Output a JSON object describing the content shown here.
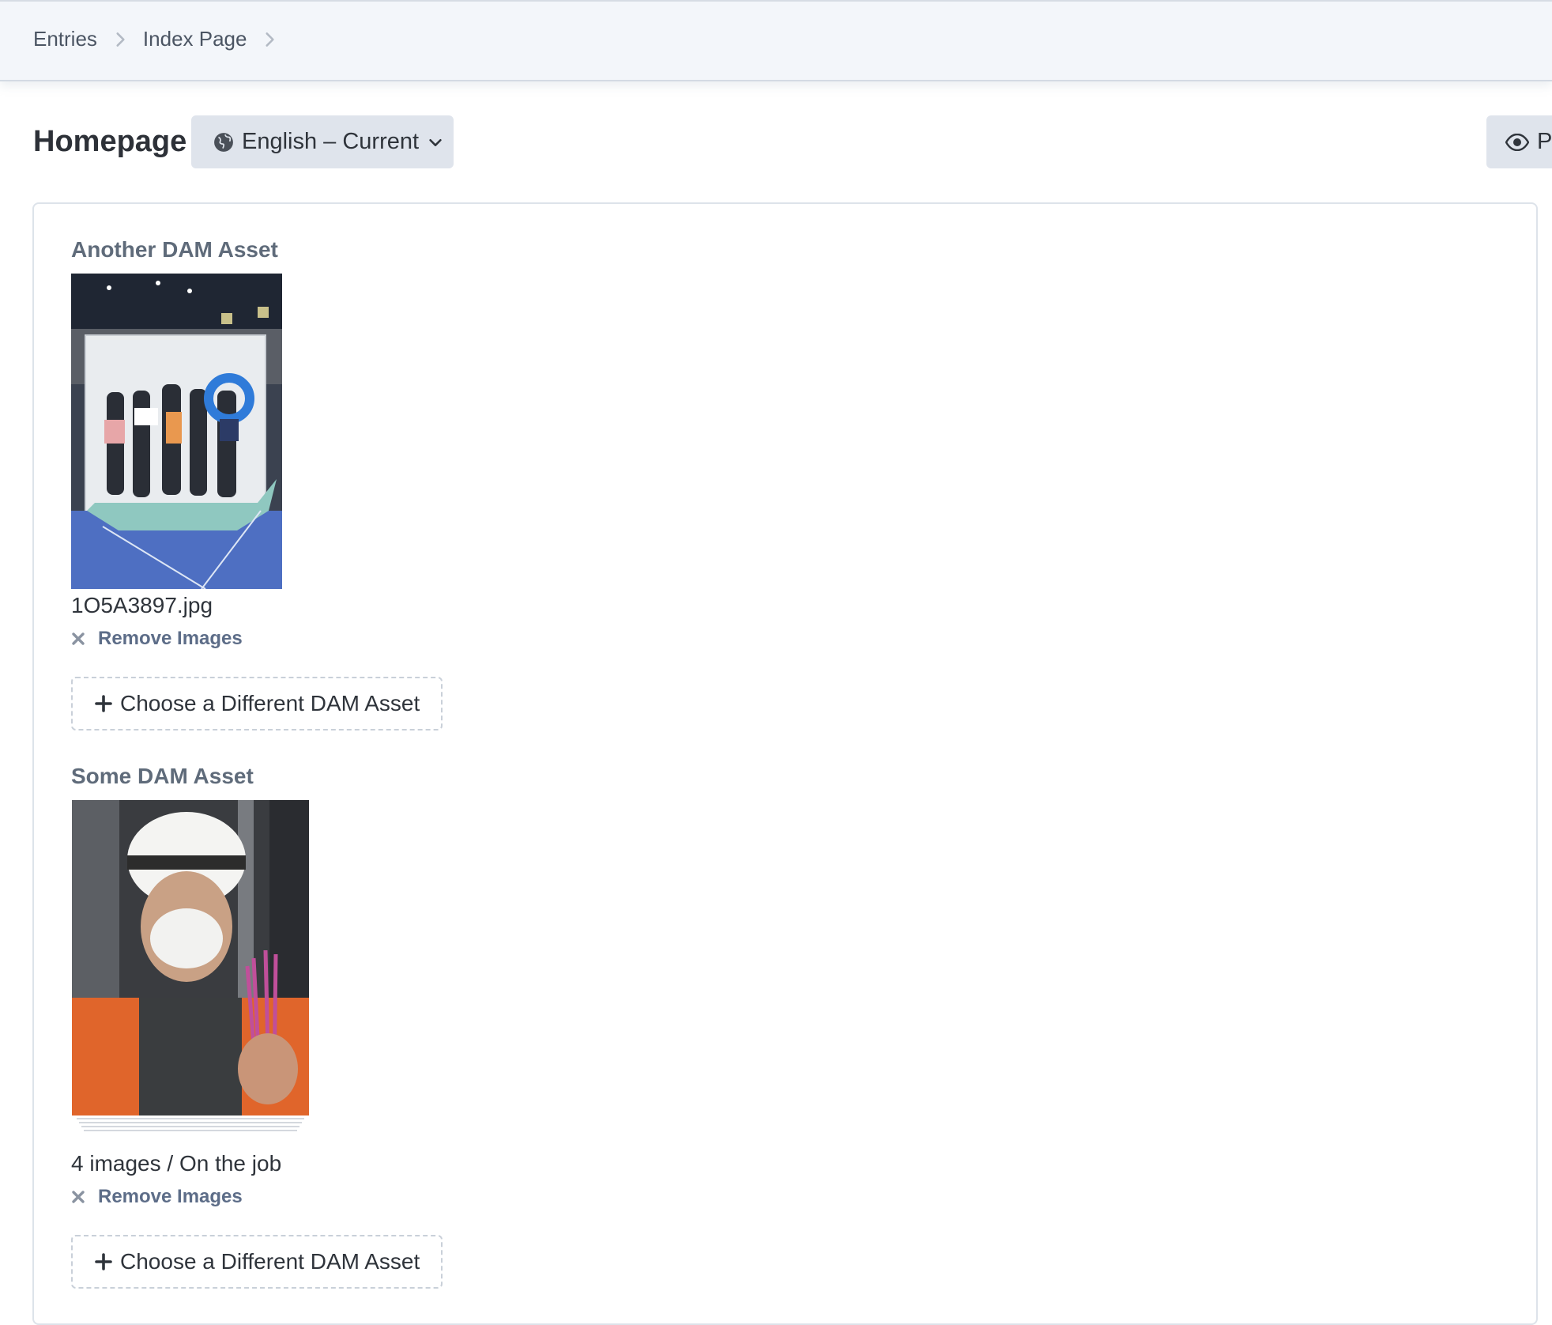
{
  "breadcrumb": {
    "items": [
      "Entries",
      "Index Page"
    ]
  },
  "page": {
    "title": "Homepage",
    "language_label": "English – Current",
    "preview_label": "Pr"
  },
  "fields": [
    {
      "label": "Another DAM Asset",
      "caption": "1O5A3897.jpg",
      "remove_label": "Remove Images",
      "choose_label": "Choose a Different DAM Asset"
    },
    {
      "label": "Some DAM Asset",
      "caption": "4 images / On the job",
      "remove_label": "Remove Images",
      "choose_label": "Choose a Different DAM Asset"
    }
  ],
  "icons": {
    "breadcrumb_separator": "chevron-right-icon",
    "language": "globe-icon",
    "dropdown": "chevron-down-icon",
    "preview": "eye-icon",
    "remove": "close-icon",
    "add": "plus-icon"
  },
  "colors": {
    "topbar_bg": "#f3f6fa",
    "button_bg": "#dfe4ec",
    "link": "#5d6d88",
    "field_label": "#5f6b7a"
  }
}
